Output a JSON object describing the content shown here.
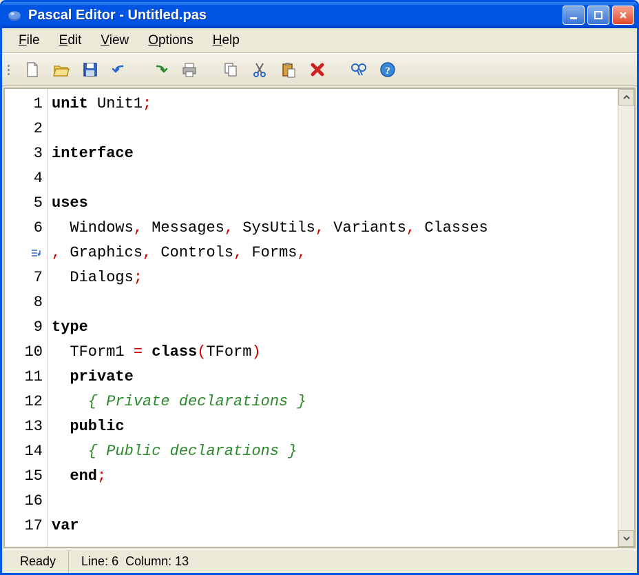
{
  "window": {
    "title": "Pascal Editor - Untitled.pas"
  },
  "menu": {
    "file": "File",
    "edit": "Edit",
    "view": "View",
    "options": "Options",
    "help": "Help"
  },
  "toolbar_icons": {
    "new": "new-file",
    "open": "open-folder",
    "save": "save-disk",
    "undo": "undo",
    "redo": "redo",
    "print": "print",
    "copy": "copy",
    "cut": "cut",
    "paste": "paste",
    "delete": "delete",
    "find": "find",
    "help": "help"
  },
  "code": {
    "gutter": [
      "1",
      "2",
      "3",
      "4",
      "5",
      "6",
      "",
      "7",
      "8",
      "9",
      "10",
      "11",
      "12",
      "13",
      "14",
      "15",
      "16",
      "17"
    ],
    "wrap_row_index": 6,
    "lines": [
      {
        "tokens": [
          {
            "t": "unit",
            "c": "kw"
          },
          {
            "t": " Unit1",
            "c": "ident"
          },
          {
            "t": ";",
            "c": "punct"
          }
        ]
      },
      {
        "tokens": []
      },
      {
        "tokens": [
          {
            "t": "interface",
            "c": "kw"
          }
        ]
      },
      {
        "tokens": []
      },
      {
        "tokens": [
          {
            "t": "uses",
            "c": "kw"
          }
        ]
      },
      {
        "tokens": [
          {
            "t": "  Windows",
            "c": "ident"
          },
          {
            "t": ",",
            "c": "punct"
          },
          {
            "t": " Messages",
            "c": "ident"
          },
          {
            "t": ",",
            "c": "punct"
          },
          {
            "t": " SysUtils",
            "c": "ident"
          },
          {
            "t": ",",
            "c": "punct"
          },
          {
            "t": " Variants",
            "c": "ident"
          },
          {
            "t": ",",
            "c": "punct"
          },
          {
            "t": " Classes",
            "c": "ident"
          }
        ]
      },
      {
        "tokens": [
          {
            "t": ",",
            "c": "punct"
          },
          {
            "t": " Graphics",
            "c": "ident"
          },
          {
            "t": ",",
            "c": "punct"
          },
          {
            "t": " Controls",
            "c": "ident"
          },
          {
            "t": ",",
            "c": "punct"
          },
          {
            "t": " Forms",
            "c": "ident"
          },
          {
            "t": ",",
            "c": "punct"
          }
        ]
      },
      {
        "tokens": [
          {
            "t": "  Dialogs",
            "c": "ident"
          },
          {
            "t": ";",
            "c": "punct"
          }
        ]
      },
      {
        "tokens": []
      },
      {
        "tokens": [
          {
            "t": "type",
            "c": "kw"
          }
        ]
      },
      {
        "tokens": [
          {
            "t": "  TForm1 ",
            "c": "ident"
          },
          {
            "t": "=",
            "c": "punct"
          },
          {
            "t": " ",
            "c": "ident"
          },
          {
            "t": "class",
            "c": "kw"
          },
          {
            "t": "(",
            "c": "punct"
          },
          {
            "t": "TForm",
            "c": "ident"
          },
          {
            "t": ")",
            "c": "punct"
          }
        ]
      },
      {
        "tokens": [
          {
            "t": "  ",
            "c": "ident"
          },
          {
            "t": "private",
            "c": "kw"
          }
        ]
      },
      {
        "tokens": [
          {
            "t": "    ",
            "c": "ident"
          },
          {
            "t": "{ Private declarations }",
            "c": "comment"
          }
        ]
      },
      {
        "tokens": [
          {
            "t": "  ",
            "c": "ident"
          },
          {
            "t": "public",
            "c": "kw"
          }
        ]
      },
      {
        "tokens": [
          {
            "t": "    ",
            "c": "ident"
          },
          {
            "t": "{ Public declarations }",
            "c": "comment"
          }
        ]
      },
      {
        "tokens": [
          {
            "t": "  ",
            "c": "ident"
          },
          {
            "t": "end",
            "c": "kw"
          },
          {
            "t": ";",
            "c": "punct"
          }
        ]
      },
      {
        "tokens": []
      },
      {
        "tokens": [
          {
            "t": "var",
            "c": "kw"
          }
        ]
      }
    ]
  },
  "status": {
    "ready": "Ready",
    "line_label": "Line:",
    "line_value": "6",
    "col_label": "Column:",
    "col_value": "13"
  }
}
